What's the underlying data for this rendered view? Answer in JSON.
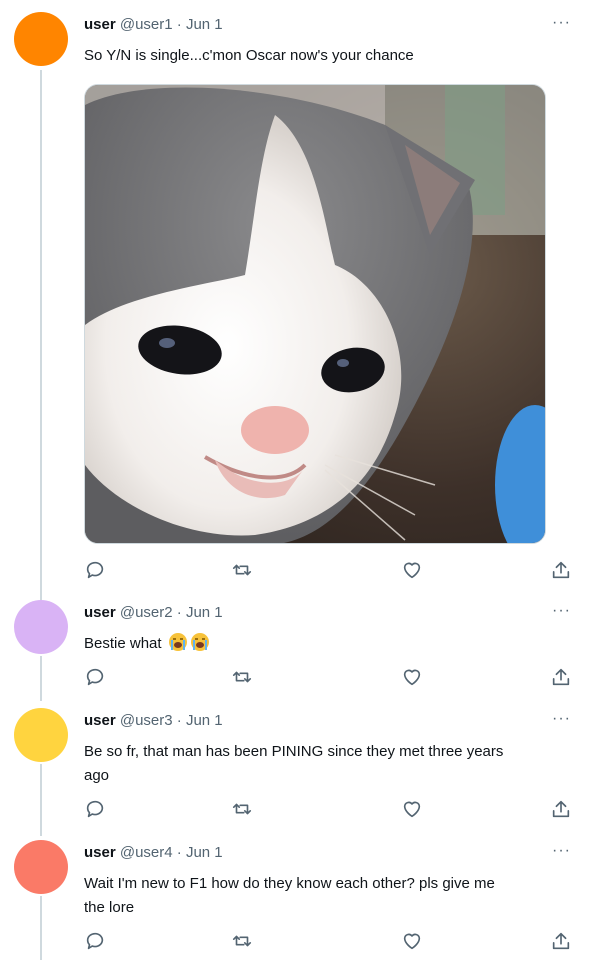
{
  "tweets": [
    {
      "name": "user",
      "handle": "@user1",
      "date": "· Jun 1",
      "text": "So Y/N is single...c'mon Oscar now's your chance",
      "avatar_color": "#FF8500",
      "has_media": true
    },
    {
      "name": "user",
      "handle": "@user2",
      "date": "· Jun 1",
      "text": "Bestie what",
      "emoji": "loudly-crying-face x2",
      "avatar_color": "#D9B3F5"
    },
    {
      "name": "user",
      "handle": "@user3",
      "date": "· Jun 1",
      "text_line1": "Be so fr, that man has been PINING since they met three years",
      "text_line2": "ago",
      "avatar_color": "#FFD43F"
    },
    {
      "name": "user",
      "handle": "@user4",
      "date": "· Jun 1",
      "text_line1": "Wait I'm new to F1 how do they know each other? pls give me",
      "text_line2": "the lore",
      "avatar_color": "#FA7A67"
    }
  ],
  "more_glyph": "···",
  "colors": {
    "thread_line": "#cfd9de",
    "meta": "#536471",
    "icon": "#536471"
  },
  "icons": [
    "reply-icon",
    "retweet-icon",
    "like-icon",
    "share-icon"
  ]
}
